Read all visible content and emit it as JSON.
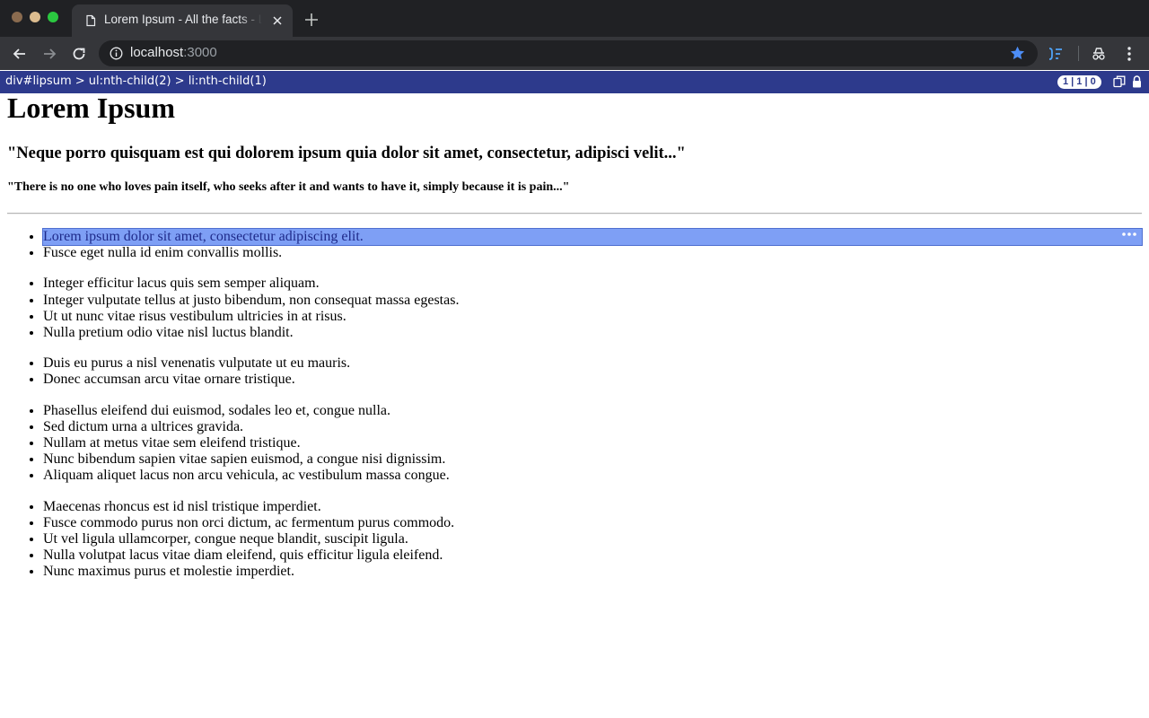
{
  "browser": {
    "tab_title": "Lorem Ipsum - All the facts - Lipsum generator",
    "url_host": "localhost",
    "url_port": ":3000"
  },
  "selector_bar": {
    "path": "div#lipsum > ul:nth-child(2) > li:nth-child(1)",
    "counter": "1 | 1 | 0"
  },
  "page": {
    "heading": "Lorem Ipsum",
    "quote_latin": "\"Neque porro quisquam est qui dolorem ipsum quia dolor sit amet, consectetur, adipisci velit...\"",
    "quote_english": "\"There is no one who loves pain itself, who seeks after it and wants to have it, simply because it is pain...\"",
    "lists": [
      {
        "items": [
          "Lorem ipsum dolor sit amet, consectetur adipiscing elit.",
          "Fusce eget nulla id enim convallis mollis."
        ]
      },
      {
        "items": [
          "Integer efficitur lacus quis sem semper aliquam.",
          "Integer vulputate tellus at justo bibendum, non consequat massa egestas.",
          "Ut ut nunc vitae risus vestibulum ultricies in at risus.",
          "Nulla pretium odio vitae nisl luctus blandit."
        ]
      },
      {
        "items": [
          "Duis eu purus a nisl venenatis vulputate ut eu mauris.",
          "Donec accumsan arcu vitae ornare tristique."
        ]
      },
      {
        "items": [
          "Phasellus eleifend dui euismod, sodales leo et, congue nulla.",
          "Sed dictum urna a ultrices gravida.",
          "Nullam at metus vitae sem eleifend tristique.",
          "Nunc bibendum sapien vitae sapien euismod, a congue nisi dignissim.",
          "Aliquam aliquet lacus non arcu vehicula, ac vestibulum massa congue."
        ]
      },
      {
        "items": [
          "Maecenas rhoncus est id nisl tristique imperdiet.",
          "Fusce commodo purus non orci dictum, ac fermentum purus commodo.",
          "Ut vel ligula ullamcorper, congue neque blandit, suscipit ligula.",
          "Nulla volutpat lacus vitae diam eleifend, quis efficitur ligula eleifend.",
          "Nunc maximus purus et molestie imperdiet."
        ]
      }
    ]
  },
  "colors": {
    "selector_bar_bg": "#2d3a8c",
    "highlight_bg": "#7e9ff5",
    "bookmark_star": "#4d8ef7"
  },
  "icons": {
    "window_controls": [
      "close-dot",
      "minimize-dot",
      "maximize-dot"
    ],
    "tab": [
      "page-icon",
      "close-icon"
    ],
    "toolbar": [
      "back-arrow-icon",
      "forward-arrow-icon",
      "reload-icon",
      "info-icon",
      "star-icon",
      "extension-icon",
      "incognito-extension-icon",
      "kebab-menu-icon"
    ],
    "selector_bar": [
      "copy-icon",
      "lock-icon"
    ],
    "highlight": [
      "more-horizontal-icon"
    ]
  }
}
